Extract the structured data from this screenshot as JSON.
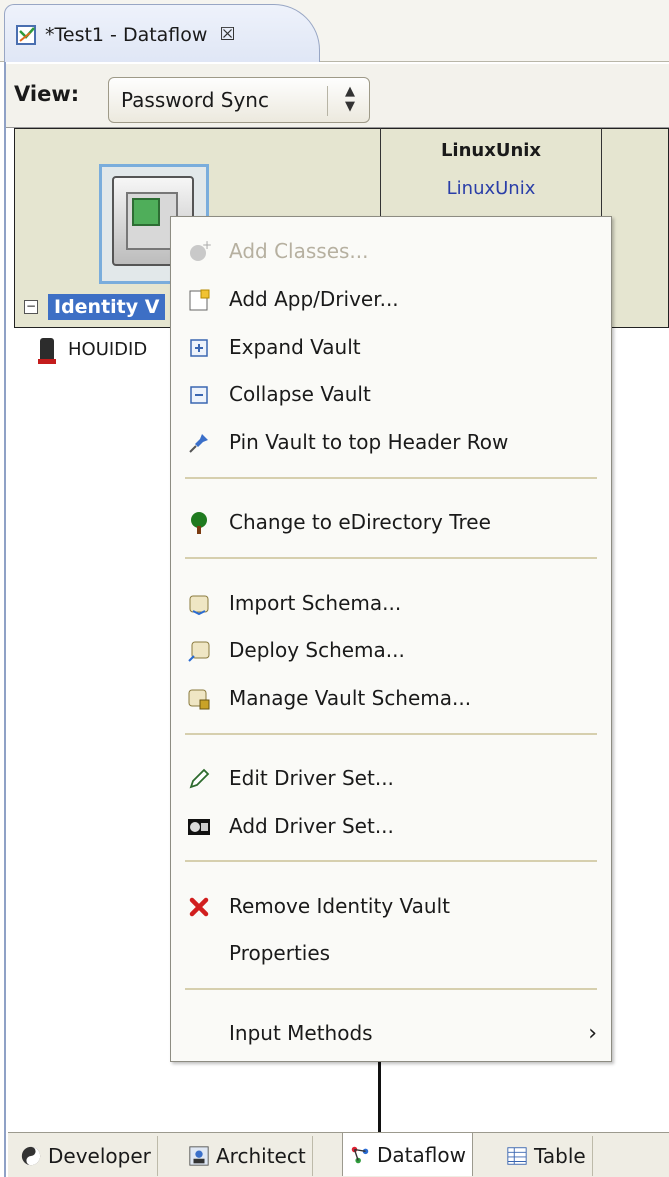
{
  "tab": {
    "title": "*Test1 - Dataflow",
    "close_glyph": "☒"
  },
  "view": {
    "label": "View:",
    "selected": "Password Sync"
  },
  "header": {
    "app_title": "LinuxUnix",
    "app_link": "LinuxUnix",
    "vault_label": "Identity V"
  },
  "tree": {
    "item": "HOUIDID"
  },
  "menu": {
    "items": [
      {
        "label": "Add Classes...",
        "icon": "add-classes-icon",
        "enabled": false
      },
      {
        "label": "Add App/Driver...",
        "icon": "add-app-driver-icon",
        "enabled": true
      },
      {
        "label": "Expand Vault",
        "icon": "expand-icon",
        "enabled": true
      },
      {
        "label": "Collapse Vault",
        "icon": "collapse-icon",
        "enabled": true
      },
      {
        "label": "Pin Vault to top Header Row",
        "icon": "pin-icon",
        "enabled": true
      },
      {
        "label": "Change to eDirectory Tree",
        "icon": "tree-icon",
        "enabled": true
      },
      {
        "label": "Import Schema...",
        "icon": "import-schema-icon",
        "enabled": true
      },
      {
        "label": "Deploy Schema...",
        "icon": "deploy-schema-icon",
        "enabled": true
      },
      {
        "label": "Manage Vault Schema...",
        "icon": "manage-schema-icon",
        "enabled": true
      },
      {
        "label": "Edit Driver Set...",
        "icon": "edit-pencil-icon",
        "enabled": true
      },
      {
        "label": "Add Driver Set...",
        "icon": "driver-set-icon",
        "enabled": true
      },
      {
        "label": "Remove Identity Vault",
        "icon": "remove-icon",
        "enabled": true
      },
      {
        "label": "Properties",
        "icon": "",
        "enabled": true
      },
      {
        "label": "Input Methods",
        "icon": "",
        "enabled": true,
        "submenu": true
      }
    ]
  },
  "bottom_tabs": [
    {
      "label": "Developer",
      "icon": "developer-icon"
    },
    {
      "label": "Architect",
      "icon": "architect-icon"
    },
    {
      "label": "Dataflow",
      "icon": "dataflow-icon",
      "active": true
    },
    {
      "label": "Table",
      "icon": "table-icon"
    }
  ]
}
